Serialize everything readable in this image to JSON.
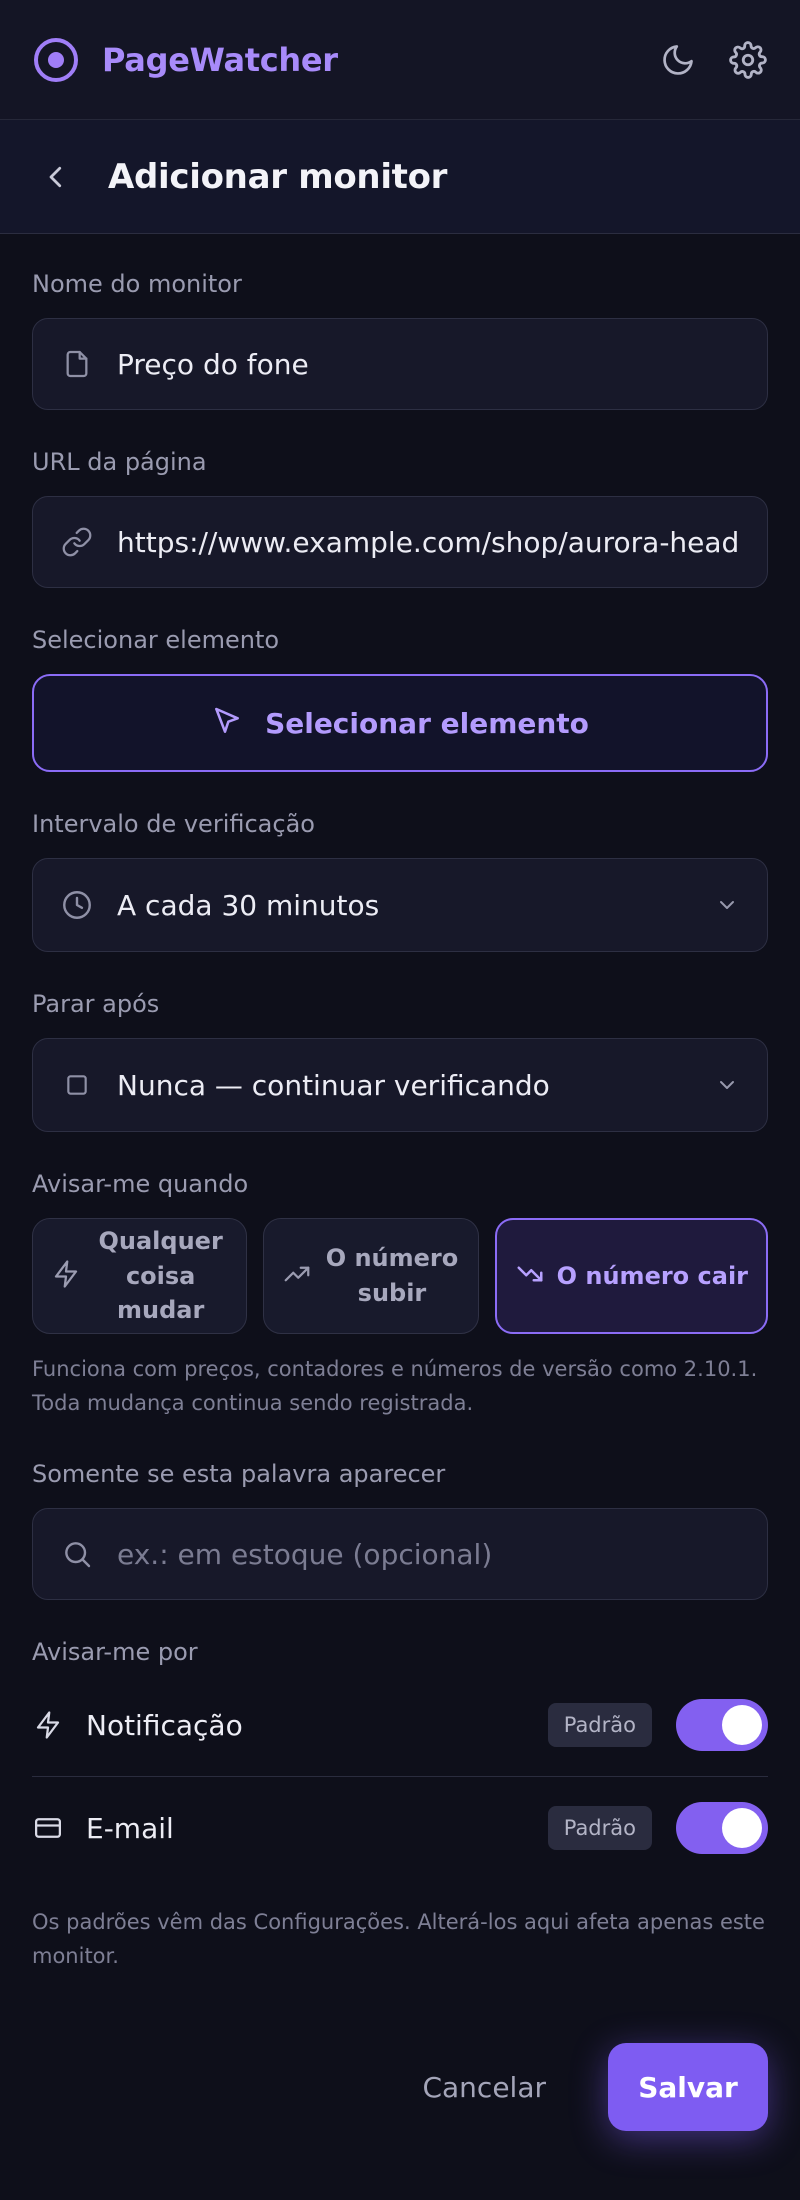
{
  "app": {
    "name": "PageWatcher"
  },
  "page": {
    "title": "Adicionar monitor"
  },
  "fields": {
    "name": {
      "label": "Nome do monitor",
      "value": "Preço do fone"
    },
    "url": {
      "label": "URL da página",
      "value": "https://www.example.com/shop/aurora-headphones"
    },
    "element": {
      "label": "Selecionar elemento",
      "button": "Selecionar elemento"
    },
    "interval": {
      "label": "Intervalo de verificação",
      "value": "A cada 30 minutos"
    },
    "stop_after": {
      "label": "Parar após",
      "value": "Nunca — continuar verificando"
    },
    "notify_when": {
      "label": "Avisar-me quando",
      "options": [
        {
          "line1": "Qualquer",
          "line2": "coisa mudar"
        },
        {
          "line1": "O número",
          "line2": "subir"
        },
        {
          "line1": "O número cair",
          "line2": ""
        }
      ],
      "selected_index": 2,
      "helper_line1": "Funciona com preços, contadores e números de versão como 2.10.1.",
      "helper_line2": "Toda mudança continua sendo registrada."
    },
    "keyword": {
      "label": "Somente se esta palavra aparecer",
      "placeholder": "ex.: em estoque (opcional)"
    },
    "channels": {
      "label": "Avisar-me por",
      "items": [
        {
          "name": "Notificação",
          "badge": "Padrão",
          "enabled": true
        },
        {
          "name": "E-mail",
          "badge": "Padrão",
          "enabled": true
        }
      ],
      "helper_line1": "Os padrões vêm das Configurações. Alterá-los aqui afeta apenas este",
      "helper_line2": "monitor."
    }
  },
  "actions": {
    "cancel": "Cancelar",
    "save": "Salvar"
  },
  "colors": {
    "accent": "#8b6cf6",
    "background": "#0e0f1a",
    "surface": "#171829"
  }
}
